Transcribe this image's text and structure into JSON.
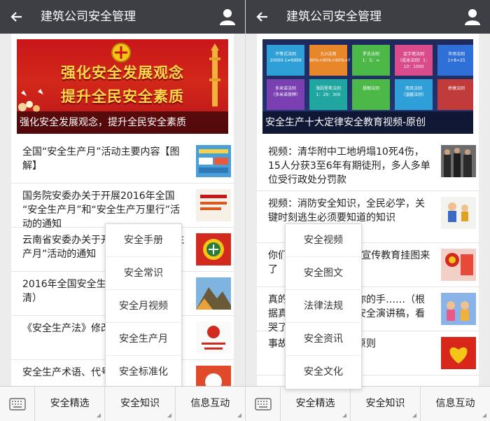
{
  "app": {
    "title": "建筑公司安全管理"
  },
  "left": {
    "banner": {
      "slogan_line1": "强化安全发展观念",
      "slogan_line2": "提升全民安全素质",
      "caption": "强化安全发展观念，提升全民安全素质"
    },
    "items": [
      {
        "text": "全国“安全生产月”活动主要内容【图解】"
      },
      {
        "text": "国务院安委办关于开展2016年全国 “安全生产月”和“安全生产万里行”活动的通知"
      },
      {
        "text": "云南省安委办关于开展2016年安全生产月”活动的通知"
      },
      {
        "text": "2016年全国安全生产月宣传片（高清）"
      },
      {
        "text": "《安全生产法》修改内容回顾"
      },
      {
        "text": "安全生产术语、代号"
      }
    ],
    "popup": [
      "安全手册",
      "安全常识",
      "安全月视频",
      "安全生产月",
      "安全标准化"
    ]
  },
  "right": {
    "banner": {
      "caption": "安全生产十大定律安全教育视频-原创",
      "tiles": [
        {
          "label": "不等式法则",
          "sub": "10000-1≠9999",
          "color": "#2f9fd8"
        },
        {
          "label": "九O法则",
          "sub": "90%×90%×90%=?",
          "color": "#e8862a"
        },
        {
          "label": "罗氏法则",
          "sub": "1：5：∞",
          "color": "#4cb848"
        },
        {
          "label": "金字塔法则",
          "sub": "（成本法则）1：10：1000",
          "color": "#d94b8a"
        },
        {
          "label": "市场法则",
          "sub": "1+8=25",
          "color": "#2f6fd8"
        },
        {
          "label": "多米诺法则",
          "sub": "（多米诺骨牌）",
          "color": "#7a3fb0"
        },
        {
          "label": "海因里希法则",
          "sub": "1：29：300",
          "color": "#1fa6a0"
        },
        {
          "label": "慧眼法则",
          "sub": "",
          "color": "#4cb848"
        },
        {
          "label": "南风法则",
          "sub": "（温暖法则）",
          "color": "#2f9fd8"
        },
        {
          "label": "桥墩法则",
          "sub": "",
          "color": "#c23b3b"
        }
      ]
    },
    "items": [
      {
        "text": "视频：清华附中工地坍塌10死4伤，15人分获3至6年有期徒刑，多人多单位受行政处分罚款"
      },
      {
        "text": "视频：消防安全知识，全民必学，关键时刻逃生必须要知道的知识"
      },
      {
        "text": "你们要的安全生产月”宣传教育挂图来了"
      },
      {
        "text": "真的不会再有下一次你的手……（根据真实事件改编）的安全演讲稿，看哭了"
      },
      {
        "text": "事故预防的九个基本原则"
      }
    ],
    "popup": [
      "安全视频",
      "安全图文",
      "法律法规",
      "安全资讯",
      "安全文化"
    ]
  },
  "tabs": [
    "安全精选",
    "安全知识",
    "信息互动"
  ],
  "colors": {
    "topbar": "#3d3f44",
    "banner_red": "#c9161a",
    "slogan_gold": "#ffd84a"
  }
}
